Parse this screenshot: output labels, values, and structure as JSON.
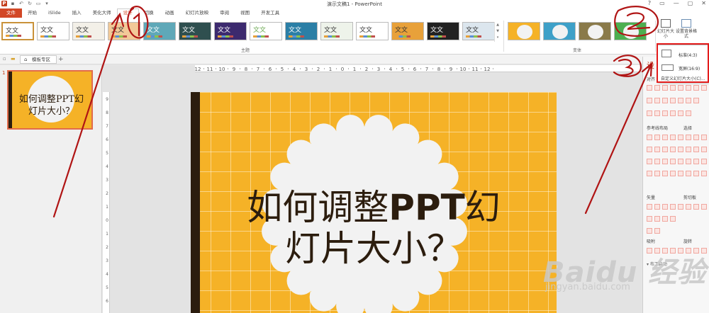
{
  "window": {
    "title": "演示文稿1 - PowerPoint",
    "controls": [
      "?",
      "▭",
      "—",
      "▢",
      "✕"
    ]
  },
  "tabs": [
    {
      "label": "文件",
      "kind": "file"
    },
    {
      "label": "开始"
    },
    {
      "label": "iSlide"
    },
    {
      "label": "插入"
    },
    {
      "label": "美化大师"
    },
    {
      "label": "设计",
      "active": true
    },
    {
      "label": "切换"
    },
    {
      "label": "动画"
    },
    {
      "label": "幻灯片放映"
    },
    {
      "label": "审阅"
    },
    {
      "label": "视图"
    },
    {
      "label": "开发工具"
    }
  ],
  "ribbon": {
    "themes_group_label": "主题",
    "variants_group_label": "变体",
    "themes": [
      {
        "label": "文文",
        "bg": "#ffffff",
        "fg": "#333333"
      },
      {
        "label": "文文",
        "bg": "#ffffff",
        "fg": "#333333"
      },
      {
        "label": "文文",
        "bg": "#f3f0e8",
        "fg": "#333333"
      },
      {
        "label": "文文",
        "bg": "#f2c998",
        "fg": "#333333"
      },
      {
        "label": "文文",
        "bg": "#5fa8b8",
        "fg": "#ffffff"
      },
      {
        "label": "文文",
        "bg": "#2f4f4f",
        "fg": "#ffffff"
      },
      {
        "label": "文文",
        "bg": "#3c2a6e",
        "fg": "#ffffff"
      },
      {
        "label": "文文",
        "bg": "#ffffff",
        "fg": "#6aa84f"
      },
      {
        "label": "文文",
        "bg": "#2b7fa6",
        "fg": "#ffffff"
      },
      {
        "label": "文文",
        "bg": "#eef3ea",
        "fg": "#333333"
      },
      {
        "label": "文文",
        "bg": "#ffffff",
        "fg": "#333333"
      },
      {
        "label": "文文",
        "bg": "#e8a13a",
        "fg": "#333333"
      },
      {
        "label": "文文",
        "bg": "#222222",
        "fg": "#ffffff"
      },
      {
        "label": "文文",
        "bg": "#dce6ee",
        "fg": "#333333"
      }
    ],
    "variants": [
      {
        "bg": "#f5b227"
      },
      {
        "bg": "#3ea0c8"
      },
      {
        "bg": "#8a7a4a"
      },
      {
        "bg": "#4caf50"
      }
    ],
    "slide_size_label": "幻灯片大小",
    "background_format_label": "设置背景格式"
  },
  "doc_tab": {
    "label": "模板专区",
    "add": "+"
  },
  "slides_pane": {
    "slide_number": "1",
    "thumb_line1": "如何调整PPT幻",
    "thumb_line2": "灯片大小？"
  },
  "slide": {
    "line1_prefix": "如何调整",
    "line1_bold": "PPT",
    "line1_suffix": "幻",
    "line2": "灯片大小？",
    "colors": {
      "background": "#f5b227",
      "stripe": "#2c1d0e",
      "scallop": "#f2f2f2",
      "text": "#2c1d0e"
    }
  },
  "ruler": {
    "labels": [
      "12",
      "11",
      "10",
      "9",
      "8",
      "7",
      "6",
      "5",
      "4",
      "3",
      "2",
      "1",
      "0",
      "1",
      "2",
      "3",
      "4",
      "5",
      "6",
      "7",
      "8",
      "9",
      "10",
      "11",
      "12"
    ],
    "vertical_labels": [
      "9",
      "8",
      "7",
      "6",
      "5",
      "4",
      "3",
      "2",
      "1",
      "0",
      "1",
      "2",
      "3",
      "4",
      "5",
      "6"
    ]
  },
  "dropdown": {
    "items": [
      {
        "label": "标准(4:3)",
        "icon": "standard-ratio-icon"
      },
      {
        "label": "宽屏(16:9)",
        "icon": "widescreen-ratio-icon"
      }
    ],
    "custom_label": "自定义幻灯片大小(C)..."
  },
  "right_pane": {
    "header": "设",
    "sections": [
      "对齐",
      "参考线布局",
      "选择",
      "矢量",
      "剪切板",
      "吸附",
      "旋转"
    ],
    "checkbox_label": "布工启动"
  },
  "annotations": {
    "circle1": "1",
    "circle2": "2",
    "circle3": "3"
  },
  "watermark": {
    "brand": "Baidu 经验",
    "url": "jingyan.baidu.com"
  }
}
